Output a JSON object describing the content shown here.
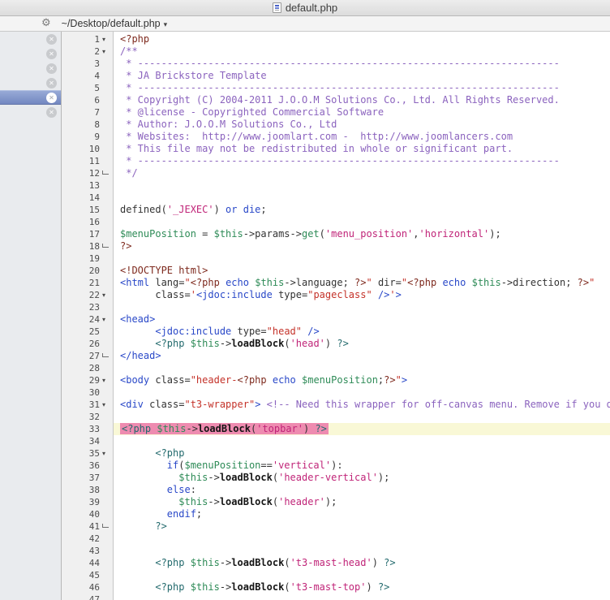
{
  "window": {
    "title": "default.php"
  },
  "toolbar": {
    "path": "~/Desktop/default.php",
    "dropdown_arrow": "▾",
    "gear_icon": "gear",
    "fold_open_icon": "▾"
  },
  "sidebar": {
    "close_icon": "✕",
    "rows": [
      {
        "selected": false
      },
      {
        "selected": false
      },
      {
        "selected": false
      },
      {
        "selected": false
      },
      {
        "selected": true
      },
      {
        "selected": false
      }
    ]
  },
  "colors": {
    "sidebar_bg": "#e9ebee",
    "gutter_bg": "#f0f0f0",
    "code_bg": "#ffffff",
    "sel_top": "#9aacd8",
    "sel_bottom": "#7085bf",
    "highlight_pink": "#ee8bb0",
    "highlight_line_yellow": "#f9f8d6",
    "text_plain": "#333333",
    "tag_blue": "#2948c8",
    "keyword_blue": "#2948c8",
    "string_magenta": "#c02478",
    "attr_value_red": "#c43229",
    "variable_green": "#2e8b57",
    "function_black": "#151515",
    "comment_purple": "#8b63be",
    "php_tag_maroon": "#7e2a1e",
    "php_tag_teal": "#236a6d"
  },
  "editor": {
    "lines": [
      {
        "n": 1,
        "fold": "open",
        "segs": [
          [
            "php",
            "<?php"
          ]
        ]
      },
      {
        "n": 2,
        "fold": "open",
        "segs": [
          [
            "com",
            "/**"
          ]
        ]
      },
      {
        "n": 3,
        "segs": [
          [
            "com",
            " * ------------------------------------------------------------------------"
          ]
        ]
      },
      {
        "n": 4,
        "segs": [
          [
            "com",
            " * JA Brickstore Template"
          ]
        ]
      },
      {
        "n": 5,
        "segs": [
          [
            "com",
            " * ------------------------------------------------------------------------"
          ]
        ]
      },
      {
        "n": 6,
        "segs": [
          [
            "com",
            " * Copyright (C) 2004-2011 J.O.O.M Solutions Co., Ltd. All Rights Reserved."
          ]
        ]
      },
      {
        "n": 7,
        "segs": [
          [
            "com",
            " * @license - Copyrighted Commercial Software"
          ]
        ]
      },
      {
        "n": 8,
        "segs": [
          [
            "com",
            " * Author: J.O.O.M Solutions Co., Ltd"
          ]
        ]
      },
      {
        "n": 9,
        "segs": [
          [
            "com",
            " * Websites:  http://www.joomlart.com -  http://www.joomlancers.com"
          ]
        ]
      },
      {
        "n": 10,
        "segs": [
          [
            "com",
            " * This file may not be redistributed in whole or significant part."
          ]
        ]
      },
      {
        "n": 11,
        "segs": [
          [
            "com",
            " * ------------------------------------------------------------------------"
          ]
        ]
      },
      {
        "n": 12,
        "fold": "end",
        "segs": [
          [
            "com",
            " */"
          ]
        ]
      },
      {
        "n": 13,
        "segs": []
      },
      {
        "n": 14,
        "segs": []
      },
      {
        "n": 15,
        "segs": [
          [
            "plain",
            "defined("
          ],
          [
            "str",
            "'_JEXEC'"
          ],
          [
            "plain",
            ") "
          ],
          [
            "kw",
            "or"
          ],
          [
            "plain",
            " "
          ],
          [
            "kw",
            "die"
          ],
          [
            "plain",
            ";"
          ]
        ]
      },
      {
        "n": 16,
        "segs": []
      },
      {
        "n": 17,
        "segs": [
          [
            "var",
            "$menuPosition"
          ],
          [
            "plain",
            " = "
          ],
          [
            "var",
            "$this"
          ],
          [
            "plain",
            "->params->"
          ],
          [
            "var",
            "get"
          ],
          [
            "plain",
            "("
          ],
          [
            "str",
            "'menu_position'"
          ],
          [
            "plain",
            ","
          ],
          [
            "str",
            "'horizontal'"
          ],
          [
            "plain",
            ");"
          ]
        ]
      },
      {
        "n": 18,
        "fold": "end",
        "segs": [
          [
            "php",
            "?>"
          ]
        ]
      },
      {
        "n": 19,
        "segs": []
      },
      {
        "n": 20,
        "segs": [
          [
            "php",
            "<!DOCTYPE html>"
          ]
        ]
      },
      {
        "n": 21,
        "segs": [
          [
            "tag",
            "<html"
          ],
          [
            "plain",
            " lang="
          ],
          [
            "attr",
            "\""
          ],
          [
            "php",
            "<?php"
          ],
          [
            "plain",
            " "
          ],
          [
            "kw",
            "echo"
          ],
          [
            "plain",
            " "
          ],
          [
            "var",
            "$this"
          ],
          [
            "plain",
            "->language; "
          ],
          [
            "php",
            "?>"
          ],
          [
            "attr",
            "\""
          ],
          [
            "plain",
            " dir="
          ],
          [
            "attr",
            "\""
          ],
          [
            "php",
            "<?php"
          ],
          [
            "plain",
            " "
          ],
          [
            "kw",
            "echo"
          ],
          [
            "plain",
            " "
          ],
          [
            "var",
            "$this"
          ],
          [
            "plain",
            "->direction; "
          ],
          [
            "php",
            "?>"
          ],
          [
            "attr",
            "\""
          ]
        ]
      },
      {
        "n": 22,
        "fold": "open",
        "segs": [
          [
            "plain",
            "      class="
          ],
          [
            "attr",
            "'"
          ],
          [
            "tag",
            "<jdoc:include"
          ],
          [
            "plain",
            " type="
          ],
          [
            "attr",
            "\"pageclass\""
          ],
          [
            "plain",
            " "
          ],
          [
            "tag",
            "/>"
          ],
          [
            "attr",
            "'"
          ],
          [
            "tag",
            ">"
          ]
        ]
      },
      {
        "n": 23,
        "segs": []
      },
      {
        "n": 24,
        "fold": "open",
        "segs": [
          [
            "tag",
            "<head>"
          ]
        ]
      },
      {
        "n": 25,
        "segs": [
          [
            "plain",
            "      "
          ],
          [
            "tag",
            "<jdoc:include"
          ],
          [
            "plain",
            " type="
          ],
          [
            "attr",
            "\"head\""
          ],
          [
            "plain",
            " "
          ],
          [
            "tag",
            "/>"
          ]
        ]
      },
      {
        "n": 26,
        "segs": [
          [
            "plain",
            "      "
          ],
          [
            "teal",
            "<?php"
          ],
          [
            "plain",
            " "
          ],
          [
            "var",
            "$this"
          ],
          [
            "plain",
            "->"
          ],
          [
            "fn",
            "loadBlock"
          ],
          [
            "plain",
            "("
          ],
          [
            "str",
            "'head'"
          ],
          [
            "plain",
            ") "
          ],
          [
            "teal",
            "?>"
          ]
        ]
      },
      {
        "n": 27,
        "fold": "end",
        "segs": [
          [
            "tag",
            "</head>"
          ]
        ]
      },
      {
        "n": 28,
        "segs": []
      },
      {
        "n": 29,
        "fold": "open",
        "segs": [
          [
            "tag",
            "<body"
          ],
          [
            "plain",
            " class="
          ],
          [
            "attr",
            "\"header-"
          ],
          [
            "php",
            "<?php"
          ],
          [
            "plain",
            " "
          ],
          [
            "kw",
            "echo"
          ],
          [
            "plain",
            " "
          ],
          [
            "var",
            "$menuPosition"
          ],
          [
            "plain",
            ";"
          ],
          [
            "php",
            "?>"
          ],
          [
            "attr",
            "\""
          ],
          [
            "tag",
            ">"
          ]
        ]
      },
      {
        "n": 30,
        "segs": []
      },
      {
        "n": 31,
        "fold": "open",
        "segs": [
          [
            "tag",
            "<div"
          ],
          [
            "plain",
            " class="
          ],
          [
            "attr",
            "\"t3-wrapper\""
          ],
          [
            "tag",
            ">"
          ],
          [
            "plain",
            " "
          ],
          [
            "com",
            "<!-- Need this wrapper for off-canvas menu. Remove if you d"
          ]
        ]
      },
      {
        "n": 32,
        "segs": []
      },
      {
        "n": 33,
        "highlight": true,
        "segs": [
          [
            "teal",
            "<?php"
          ],
          [
            "plain",
            " "
          ],
          [
            "var",
            "$this"
          ],
          [
            "plain",
            "->"
          ],
          [
            "fn",
            "loadBlock"
          ],
          [
            "plain",
            "("
          ],
          [
            "str",
            "'topbar'"
          ],
          [
            "plain",
            ") "
          ],
          [
            "teal",
            "?>"
          ]
        ]
      },
      {
        "n": 34,
        "segs": []
      },
      {
        "n": 35,
        "fold": "open",
        "segs": [
          [
            "plain",
            "      "
          ],
          [
            "teal",
            "<?php"
          ]
        ]
      },
      {
        "n": 36,
        "segs": [
          [
            "plain",
            "        "
          ],
          [
            "kw",
            "if"
          ],
          [
            "plain",
            "("
          ],
          [
            "var",
            "$menuPosition"
          ],
          [
            "plain",
            "=="
          ],
          [
            "str",
            "'vertical'"
          ],
          [
            "plain",
            "):"
          ]
        ]
      },
      {
        "n": 37,
        "segs": [
          [
            "plain",
            "          "
          ],
          [
            "var",
            "$this"
          ],
          [
            "plain",
            "->"
          ],
          [
            "fn",
            "loadBlock"
          ],
          [
            "plain",
            "("
          ],
          [
            "str",
            "'header-vertical'"
          ],
          [
            "plain",
            ");"
          ]
        ]
      },
      {
        "n": 38,
        "segs": [
          [
            "plain",
            "        "
          ],
          [
            "kw",
            "else"
          ],
          [
            "plain",
            ":"
          ]
        ]
      },
      {
        "n": 39,
        "segs": [
          [
            "plain",
            "          "
          ],
          [
            "var",
            "$this"
          ],
          [
            "plain",
            "->"
          ],
          [
            "fn",
            "loadBlock"
          ],
          [
            "plain",
            "("
          ],
          [
            "str",
            "'header'"
          ],
          [
            "plain",
            ");"
          ]
        ]
      },
      {
        "n": 40,
        "segs": [
          [
            "plain",
            "        "
          ],
          [
            "kw",
            "endif"
          ],
          [
            "plain",
            ";"
          ]
        ]
      },
      {
        "n": 41,
        "fold": "end",
        "segs": [
          [
            "plain",
            "      "
          ],
          [
            "teal",
            "?>"
          ]
        ]
      },
      {
        "n": 42,
        "segs": []
      },
      {
        "n": 43,
        "segs": []
      },
      {
        "n": 44,
        "segs": [
          [
            "plain",
            "      "
          ],
          [
            "teal",
            "<?php"
          ],
          [
            "plain",
            " "
          ],
          [
            "var",
            "$this"
          ],
          [
            "plain",
            "->"
          ],
          [
            "fn",
            "loadBlock"
          ],
          [
            "plain",
            "("
          ],
          [
            "str",
            "'t3-mast-head'"
          ],
          [
            "plain",
            ") "
          ],
          [
            "teal",
            "?>"
          ]
        ]
      },
      {
        "n": 45,
        "segs": []
      },
      {
        "n": 46,
        "segs": [
          [
            "plain",
            "      "
          ],
          [
            "teal",
            "<?php"
          ],
          [
            "plain",
            " "
          ],
          [
            "var",
            "$this"
          ],
          [
            "plain",
            "->"
          ],
          [
            "fn",
            "loadBlock"
          ],
          [
            "plain",
            "("
          ],
          [
            "str",
            "'t3-mast-top'"
          ],
          [
            "plain",
            ") "
          ],
          [
            "teal",
            "?>"
          ]
        ]
      },
      {
        "n": 47,
        "segs": []
      }
    ]
  }
}
